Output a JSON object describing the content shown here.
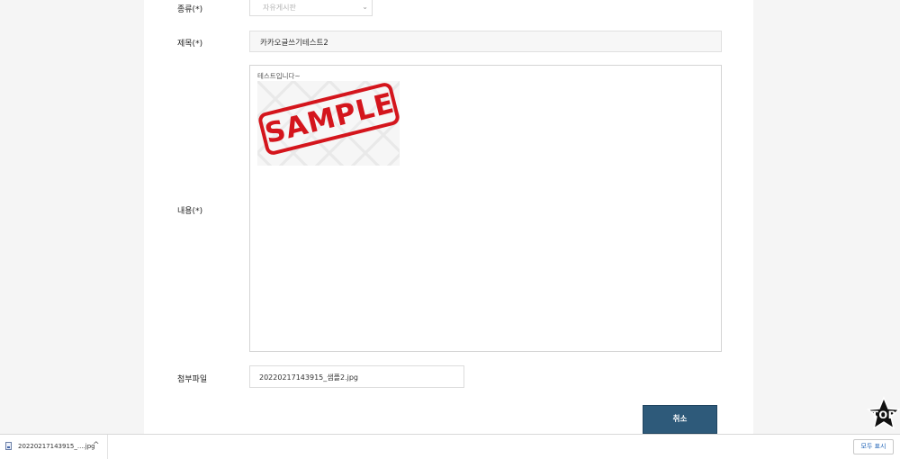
{
  "form": {
    "kind_label": "종류(*)",
    "kind_value": "자유게시판",
    "title_label": "제목(*)",
    "title_value": "카카오글쓰기테스트2",
    "content_label": "내용(*)",
    "content_text": "테스트입니다~",
    "sample_stamp": "SAMPLE",
    "attach_label": "첨부파일",
    "attach_filename": "20220217143915_샘플2.jpg",
    "cancel_label": "취소"
  },
  "top_button": {
    "label": "TOP"
  },
  "download_bar": {
    "file_name": "20220217143915_....jpg",
    "chevron": "^",
    "show_all_label": "모두 표시"
  },
  "colors": {
    "button_primary": "#2e5a7a",
    "stamp_red": "#d4151c",
    "top_badge": "#111111"
  }
}
